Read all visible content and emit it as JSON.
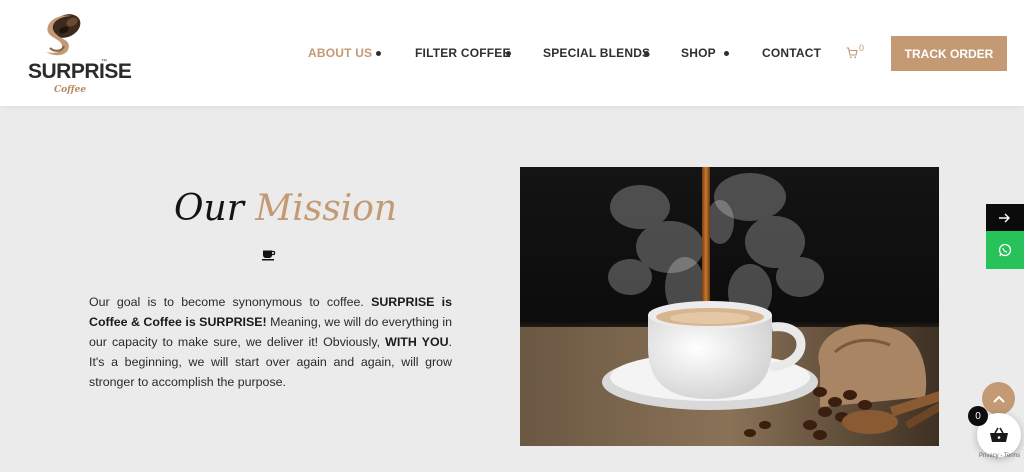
{
  "brand": {
    "name": "SURPRISE",
    "trademark": "™",
    "sub": "Coffee"
  },
  "nav": {
    "items": [
      {
        "label": "ABOUT US",
        "active": true
      },
      {
        "label": "FILTER COFFEE",
        "active": false
      },
      {
        "label": "SPECIAL BLENDS",
        "active": false
      },
      {
        "label": "SHOP",
        "active": false
      },
      {
        "label": "CONTACT",
        "active": false
      }
    ],
    "cart_count": "0",
    "track_order_label": "TRACK ORDER"
  },
  "mission": {
    "title_part1": "Our",
    "title_part2": "Mission",
    "text_1": "Our goal is to become synonymous to coffee. ",
    "bold_1": "SURPRISE is Coffee & Coffee is SURPRISE!",
    "text_2": " Meaning, we will do everything in our capacity to make sure, we deliver it! Obviously, ",
    "bold_2": "WITH YOU",
    "text_3": ". It's a beginning, we will start over again and again, will grow stronger to accomplish the purpose."
  },
  "floating": {
    "basket_count": "0",
    "recaptcha_text": "Privacy - Terms"
  },
  "colors": {
    "accent": "#c39a74",
    "background": "#ebebeb",
    "whatsapp": "#27c25a",
    "dark": "#0b0b0b"
  },
  "icons": [
    "coffee-bean-logo-icon",
    "cart-icon",
    "coffee-cup-icon",
    "arrow-right-icon",
    "whatsapp-icon",
    "chevron-up-icon",
    "basket-icon"
  ]
}
